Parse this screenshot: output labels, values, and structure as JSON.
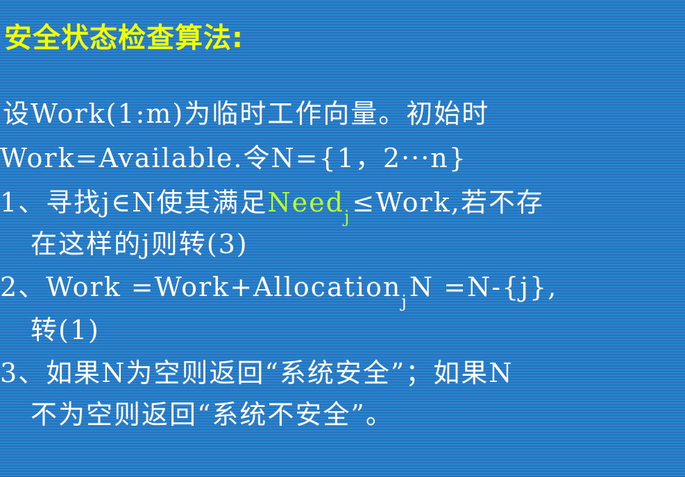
{
  "slide": {
    "title": "安全状态检查算法:",
    "line1": "设Work(1:m)为临时工作向量。初始时",
    "line2": "Work=Available.令N={1，2···n}",
    "line3": {
      "before": "1、寻找j∈N使其满足",
      "need": "Need",
      "need_sub": "j",
      "after": "≤Work,若不存"
    },
    "line4": "在这样的j则转(3)",
    "line5": {
      "before": "2、Work =Work+Allocation",
      "sub": "j",
      "after": "N =N-{j},"
    },
    "line6": "转(1)",
    "line7": "3、如果N为空则返回“系统安全”；如果N",
    "line8": "不为空则返回“系统不安全”。"
  },
  "colors": {
    "background": "#2a82cc",
    "title": "#f2ff00",
    "text": "#ffffff",
    "highlight": "#b6ff2e"
  }
}
